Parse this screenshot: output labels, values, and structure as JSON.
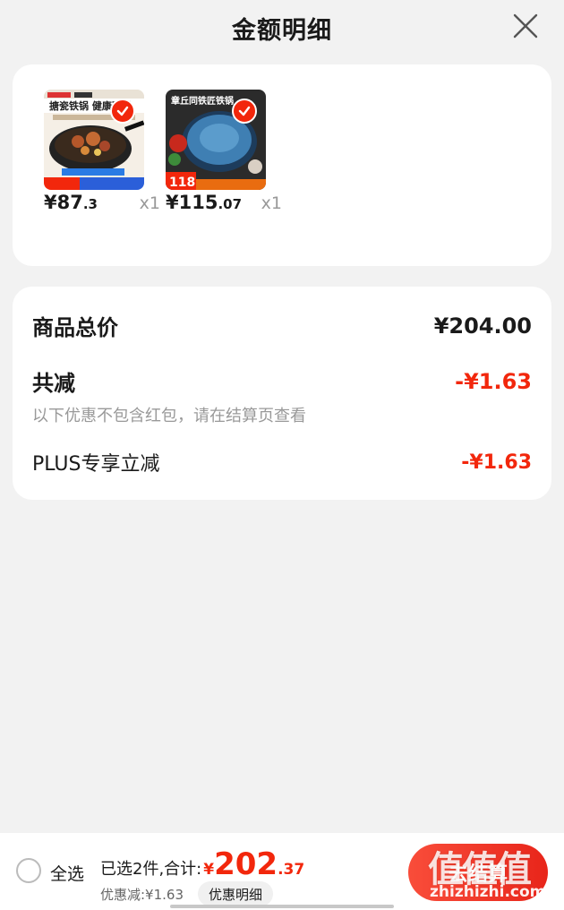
{
  "header": {
    "title": "金额明细"
  },
  "products": [
    {
      "price_int": "¥87",
      "price_dec": ".3",
      "qty": "x1",
      "image_text": "搪瓷铁锅 健康不锈"
    },
    {
      "price_int": "¥115",
      "price_dec": ".07",
      "qty": "x1",
      "image_text": "章丘同铁匠铁锅",
      "image_badge": "118"
    }
  ],
  "summary": {
    "total_label": "商品总价",
    "total_value": "¥204.00",
    "reduce_label": "共减",
    "reduce_value": "-¥1.63",
    "note": "以下优惠不包含红包，请在结算页查看",
    "plus_label": "PLUS专享立减",
    "plus_value": "-¥1.63"
  },
  "bottom": {
    "select_all": "全选",
    "selected_label": "已选2件,合计:",
    "total_symbol": "¥",
    "total_int": "202",
    "total_dec": ".37",
    "discount_text": "优惠减:¥1.63",
    "discount_detail": "优惠明细",
    "checkout": "去结算"
  },
  "watermark": {
    "main": "值值值",
    "sub": "zhizhizhi.com"
  },
  "colors": {
    "accent": "#f2270c",
    "background": "#f2f2f2"
  }
}
